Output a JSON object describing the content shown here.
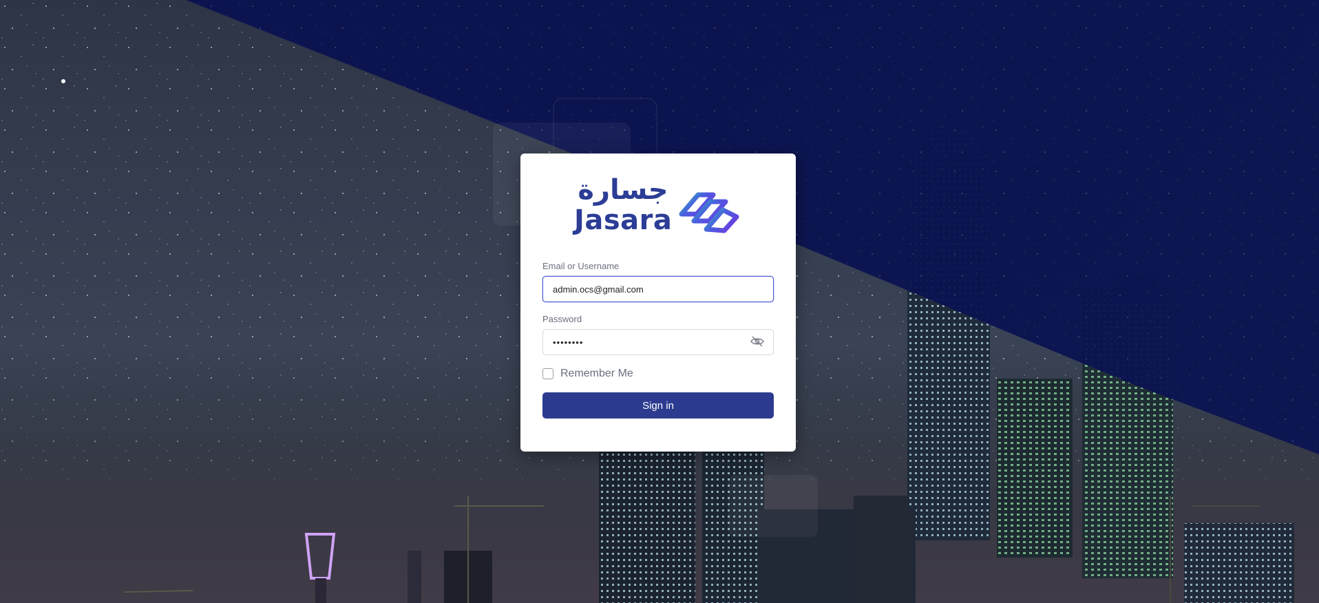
{
  "brand": {
    "name_arabic": "جسارة",
    "name_latin": "Jasara",
    "color": "#2c3d96",
    "mark_colors": [
      "#2bc0b0",
      "#4a5ee0",
      "#6b3fe0"
    ]
  },
  "login": {
    "email_label": "Email or Username",
    "email_value": "admin.ocs@gmail.com",
    "password_label": "Password",
    "password_value": "••••••••",
    "password_toggle_icon": "eye-off-icon",
    "remember_label": "Remember Me",
    "remember_checked": false,
    "signin_label": "Sign in",
    "signin_color": "#2c3b8f"
  }
}
